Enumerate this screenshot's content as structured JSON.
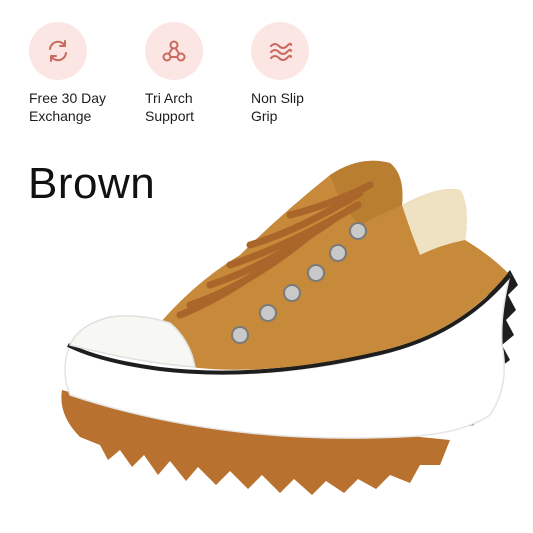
{
  "features": [
    {
      "icon": "exchange-arrows-icon",
      "line1": "Free 30 Day",
      "line2": "Exchange"
    },
    {
      "icon": "tri-arch-icon",
      "line1": "Tri Arch",
      "line2": "Support"
    },
    {
      "icon": "waves-icon",
      "line1": "Non Slip",
      "line2": "Grip"
    }
  ],
  "color_name": "Brown",
  "colors": {
    "icon_bg": "#fbe6e3",
    "icon_stroke": "#c96a5e",
    "canvas": "#c68a3a",
    "gum_sole": "#b8712f",
    "midsole": "#ffffff",
    "lugs": "#1e1e1e"
  }
}
